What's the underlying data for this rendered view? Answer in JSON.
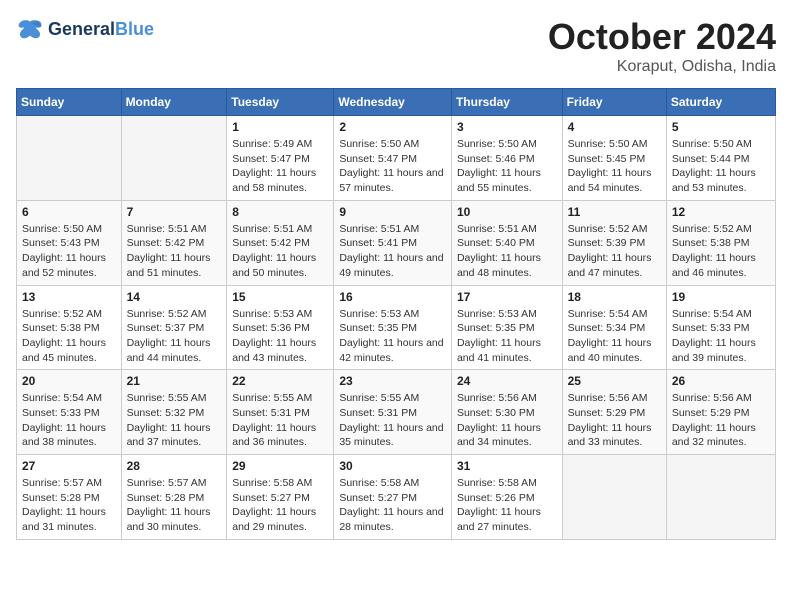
{
  "logo": {
    "line1": "General",
    "line2": "Blue"
  },
  "title": "October 2024",
  "location": "Koraput, Odisha, India",
  "days_of_week": [
    "Sunday",
    "Monday",
    "Tuesday",
    "Wednesday",
    "Thursday",
    "Friday",
    "Saturday"
  ],
  "weeks": [
    [
      {
        "day": "",
        "info": ""
      },
      {
        "day": "",
        "info": ""
      },
      {
        "day": "1",
        "sunrise": "5:49 AM",
        "sunset": "5:47 PM",
        "daylight": "11 hours and 58 minutes."
      },
      {
        "day": "2",
        "sunrise": "5:50 AM",
        "sunset": "5:47 PM",
        "daylight": "11 hours and 57 minutes."
      },
      {
        "day": "3",
        "sunrise": "5:50 AM",
        "sunset": "5:46 PM",
        "daylight": "11 hours and 55 minutes."
      },
      {
        "day": "4",
        "sunrise": "5:50 AM",
        "sunset": "5:45 PM",
        "daylight": "11 hours and 54 minutes."
      },
      {
        "day": "5",
        "sunrise": "5:50 AM",
        "sunset": "5:44 PM",
        "daylight": "11 hours and 53 minutes."
      }
    ],
    [
      {
        "day": "6",
        "sunrise": "5:50 AM",
        "sunset": "5:43 PM",
        "daylight": "11 hours and 52 minutes."
      },
      {
        "day": "7",
        "sunrise": "5:51 AM",
        "sunset": "5:42 PM",
        "daylight": "11 hours and 51 minutes."
      },
      {
        "day": "8",
        "sunrise": "5:51 AM",
        "sunset": "5:42 PM",
        "daylight": "11 hours and 50 minutes."
      },
      {
        "day": "9",
        "sunrise": "5:51 AM",
        "sunset": "5:41 PM",
        "daylight": "11 hours and 49 minutes."
      },
      {
        "day": "10",
        "sunrise": "5:51 AM",
        "sunset": "5:40 PM",
        "daylight": "11 hours and 48 minutes."
      },
      {
        "day": "11",
        "sunrise": "5:52 AM",
        "sunset": "5:39 PM",
        "daylight": "11 hours and 47 minutes."
      },
      {
        "day": "12",
        "sunrise": "5:52 AM",
        "sunset": "5:38 PM",
        "daylight": "11 hours and 46 minutes."
      }
    ],
    [
      {
        "day": "13",
        "sunrise": "5:52 AM",
        "sunset": "5:38 PM",
        "daylight": "11 hours and 45 minutes."
      },
      {
        "day": "14",
        "sunrise": "5:52 AM",
        "sunset": "5:37 PM",
        "daylight": "11 hours and 44 minutes."
      },
      {
        "day": "15",
        "sunrise": "5:53 AM",
        "sunset": "5:36 PM",
        "daylight": "11 hours and 43 minutes."
      },
      {
        "day": "16",
        "sunrise": "5:53 AM",
        "sunset": "5:35 PM",
        "daylight": "11 hours and 42 minutes."
      },
      {
        "day": "17",
        "sunrise": "5:53 AM",
        "sunset": "5:35 PM",
        "daylight": "11 hours and 41 minutes."
      },
      {
        "day": "18",
        "sunrise": "5:54 AM",
        "sunset": "5:34 PM",
        "daylight": "11 hours and 40 minutes."
      },
      {
        "day": "19",
        "sunrise": "5:54 AM",
        "sunset": "5:33 PM",
        "daylight": "11 hours and 39 minutes."
      }
    ],
    [
      {
        "day": "20",
        "sunrise": "5:54 AM",
        "sunset": "5:33 PM",
        "daylight": "11 hours and 38 minutes."
      },
      {
        "day": "21",
        "sunrise": "5:55 AM",
        "sunset": "5:32 PM",
        "daylight": "11 hours and 37 minutes."
      },
      {
        "day": "22",
        "sunrise": "5:55 AM",
        "sunset": "5:31 PM",
        "daylight": "11 hours and 36 minutes."
      },
      {
        "day": "23",
        "sunrise": "5:55 AM",
        "sunset": "5:31 PM",
        "daylight": "11 hours and 35 minutes."
      },
      {
        "day": "24",
        "sunrise": "5:56 AM",
        "sunset": "5:30 PM",
        "daylight": "11 hours and 34 minutes."
      },
      {
        "day": "25",
        "sunrise": "5:56 AM",
        "sunset": "5:29 PM",
        "daylight": "11 hours and 33 minutes."
      },
      {
        "day": "26",
        "sunrise": "5:56 AM",
        "sunset": "5:29 PM",
        "daylight": "11 hours and 32 minutes."
      }
    ],
    [
      {
        "day": "27",
        "sunrise": "5:57 AM",
        "sunset": "5:28 PM",
        "daylight": "11 hours and 31 minutes."
      },
      {
        "day": "28",
        "sunrise": "5:57 AM",
        "sunset": "5:28 PM",
        "daylight": "11 hours and 30 minutes."
      },
      {
        "day": "29",
        "sunrise": "5:58 AM",
        "sunset": "5:27 PM",
        "daylight": "11 hours and 29 minutes."
      },
      {
        "day": "30",
        "sunrise": "5:58 AM",
        "sunset": "5:27 PM",
        "daylight": "11 hours and 28 minutes."
      },
      {
        "day": "31",
        "sunrise": "5:58 AM",
        "sunset": "5:26 PM",
        "daylight": "11 hours and 27 minutes."
      },
      {
        "day": "",
        "info": ""
      },
      {
        "day": "",
        "info": ""
      }
    ]
  ],
  "labels": {
    "sunrise_prefix": "Sunrise: ",
    "sunset_prefix": "Sunset: ",
    "daylight_prefix": "Daylight: "
  }
}
